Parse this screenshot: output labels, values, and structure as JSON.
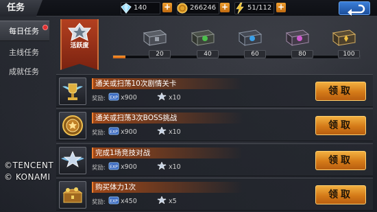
{
  "header": {
    "title": "任务",
    "diamonds": "140",
    "gold": "266246",
    "stamina": "51/112"
  },
  "sidebar": {
    "items": [
      {
        "label": "每日任务",
        "active": true,
        "badge": true
      },
      {
        "label": "主线任务",
        "active": false
      },
      {
        "label": "成就任务",
        "active": false
      }
    ]
  },
  "activity": {
    "label": "活跃度",
    "progress": 0.05,
    "chests": [
      {
        "points": "20",
        "color": "#9aa0aa"
      },
      {
        "points": "40",
        "color": "#4cc04c"
      },
      {
        "points": "60",
        "color": "#3aa0e8"
      },
      {
        "points": "80",
        "color": "#d05ad0"
      },
      {
        "points": "100",
        "color": "#e0a030"
      }
    ]
  },
  "tasks": [
    {
      "name": "通关或扫荡10次剧情关卡",
      "reward_label": "奖励:",
      "exp": "x900",
      "stars": "x10",
      "button": "领取",
      "icon": "winged-trophy-icon"
    },
    {
      "name": "通关或扫荡3次BOSS挑战",
      "reward_label": "奖励:",
      "exp": "x900",
      "stars": "x10",
      "button": "领取",
      "icon": "gold-medal-icon"
    },
    {
      "name": "完成1场竞技对战",
      "reward_label": "奖励:",
      "exp": "x900",
      "stars": "x10",
      "button": "领取",
      "icon": "winged-star-badge-icon"
    },
    {
      "name": "购买体力1次",
      "reward_label": "奖励:",
      "exp": "x450",
      "stars": "x5",
      "button": "领取",
      "icon": "treasure-chest-icon"
    }
  ],
  "watermark": {
    "line1": "©TENCENT",
    "line2": "© KONAMI"
  },
  "colors": {
    "accent": "#e08a20",
    "banner": "#9a3418"
  }
}
